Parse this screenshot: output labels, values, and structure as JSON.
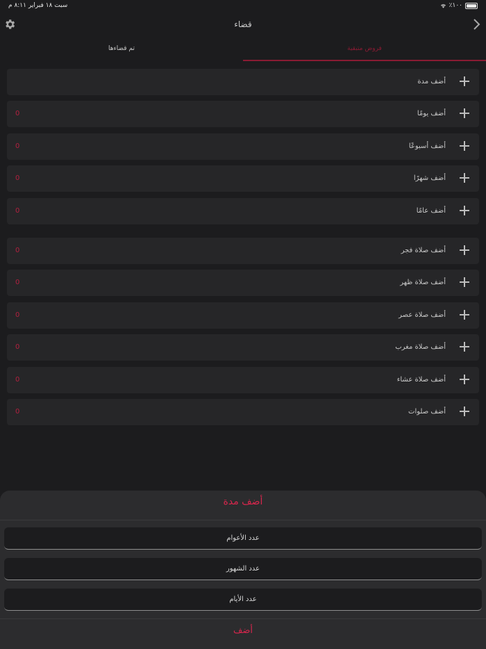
{
  "status": {
    "time": "٨:١١ م",
    "date": "سبت ١٨ فبراير",
    "battery": "٪١٠٠"
  },
  "nav": {
    "title": "قضاء"
  },
  "tabs": [
    {
      "label": "تم قضاءها",
      "active": false
    },
    {
      "label": "فروض متبقية",
      "active": true
    }
  ],
  "rows": [
    {
      "label": "أضف مدة",
      "count": ""
    },
    {
      "label": "أضف يومًا",
      "count": "0"
    },
    {
      "label": "أضف أسبوعًا",
      "count": "0"
    },
    {
      "label": "أضف شهرًا",
      "count": "0"
    },
    {
      "label": "أضف عامًا",
      "count": "0"
    },
    {
      "label": "أضف صلاة فجر",
      "count": "0"
    },
    {
      "label": "أضف صلاة ظهر",
      "count": "0"
    },
    {
      "label": "أضف صلاة عصر",
      "count": "0"
    },
    {
      "label": "أضف صلاة مغرب",
      "count": "0"
    },
    {
      "label": "أضف صلاة عشاء",
      "count": "0"
    },
    {
      "label": "أضف صلوات",
      "count": "0"
    }
  ],
  "sheet": {
    "title": "أضف مدة",
    "fields": [
      {
        "placeholder": "عدد الأعوام"
      },
      {
        "placeholder": "عدد الشهور"
      },
      {
        "placeholder": "عدد الأيام"
      }
    ],
    "add_label": "أضف"
  },
  "colors": {
    "accent": "#d8264d",
    "background": "#1c1c1e",
    "row": "#262628"
  },
  "icons": {
    "settings": "gear-icon",
    "back": "chevron-right-icon",
    "wifi": "wifi-icon",
    "battery": "battery-icon",
    "row": "plus-icon"
  }
}
